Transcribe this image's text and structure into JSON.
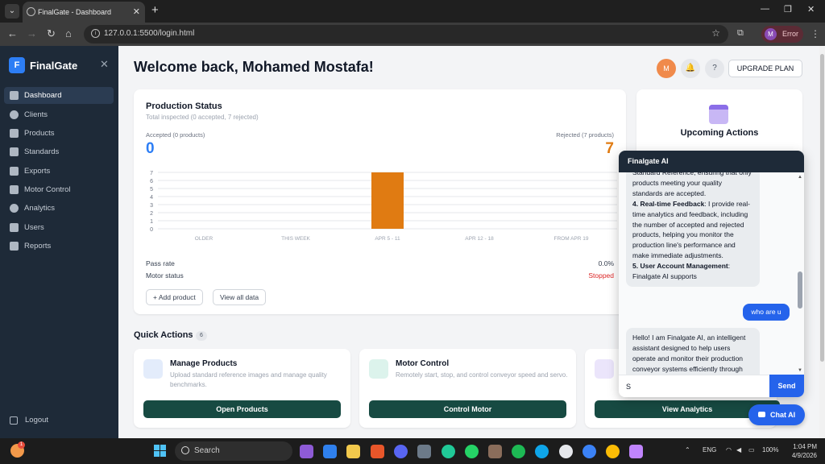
{
  "browser": {
    "tab_title": "FinalGate - Dashboard",
    "url": "127.0.0.1:5500/login.html",
    "profile_initial": "M",
    "profile_status": "Error"
  },
  "sidebar": {
    "logo_letter": "F",
    "brand": "FinalGate",
    "items": [
      {
        "label": "Dashboard",
        "icon": "dashboard-icon",
        "active": true
      },
      {
        "label": "Clients",
        "icon": "users-icon"
      },
      {
        "label": "Products",
        "icon": "box-icon"
      },
      {
        "label": "Standards",
        "icon": "image-icon"
      },
      {
        "label": "Exports",
        "icon": "export-icon"
      },
      {
        "label": "Motor Control",
        "icon": "factory-icon"
      },
      {
        "label": "Analytics",
        "icon": "chart-pie-icon"
      },
      {
        "label": "Users",
        "icon": "user-list-icon"
      },
      {
        "label": "Reports",
        "icon": "report-icon"
      }
    ],
    "logout": "Logout"
  },
  "header": {
    "welcome": "Welcome back, Mohamed Mostafa!",
    "avatar_initial": "M",
    "upgrade": "UPGRADE PLAN"
  },
  "production": {
    "title": "Production Status",
    "subtitle": "Total inspected (0 accepted, 7 rejected)",
    "accepted_label": "Accepted (0 products)",
    "accepted_value": "0",
    "rejected_label": "Rejected (7 products)",
    "rejected_value": "7",
    "pass_rate_label": "Pass rate",
    "pass_rate_value": "0.0%",
    "motor_status_label": "Motor status",
    "motor_status_value": "Stopped",
    "add_product": "Add product",
    "view_all": "View all data"
  },
  "chart_data": {
    "type": "bar",
    "categories": [
      "OLDER",
      "THIS WEEK",
      "APR 5 - 11",
      "APR 12 - 18",
      "FROM APR 19"
    ],
    "values": [
      0,
      0,
      7,
      0,
      0
    ],
    "yticks": [
      "0",
      "1",
      "2",
      "3",
      "4",
      "5",
      "6",
      "7"
    ],
    "ylim": [
      0,
      7
    ],
    "bar_color": "#e07b12",
    "grid": true
  },
  "upcoming": {
    "title": "Upcoming Actions"
  },
  "quick_actions": {
    "title": "Quick Actions",
    "count": "6",
    "cards": [
      {
        "title": "Manage Products",
        "desc": "Upload standard reference images and manage quality benchmarks.",
        "button": "Open Products",
        "icon": "document-icon"
      },
      {
        "title": "Motor Control",
        "desc": "Remotely start, stop, and control conveyor speed and servo.",
        "button": "Control Motor",
        "icon": "factory-icon"
      },
      {
        "title": "",
        "desc": "",
        "button": "View Analytics",
        "icon": "link-icon"
      }
    ]
  },
  "chat": {
    "title": "Finalgate AI",
    "msg1_pre": "Standard Reference, ensuring that only products meeting your quality standards are accepted.",
    "msg1_item4_num": "4.",
    "msg1_item4_bold": "Real-time Feedback",
    "msg1_item4_text": ": I provide real-time analytics and feedback, including the number of accepted and rejected products, helping you monitor the production line's performance and make immediate adjustments.",
    "msg1_item5_num": "5.",
    "msg1_item5_bold": "User Account Management",
    "msg1_item5_text": ": Finalgate AI supports",
    "user_msg": "who are u",
    "msg2": "Hello! I am Finalgate AI, an intelligent assistant designed to help users operate and monitor their production conveyor systems efficiently through",
    "input_value": "S",
    "send": "Send",
    "launcher": "Chat AI"
  },
  "taskbar": {
    "search": "Search",
    "lang": "ENG",
    "battery": "100%",
    "time": "1:04 PM",
    "date": "4/9/2026",
    "notif_count": "1"
  }
}
